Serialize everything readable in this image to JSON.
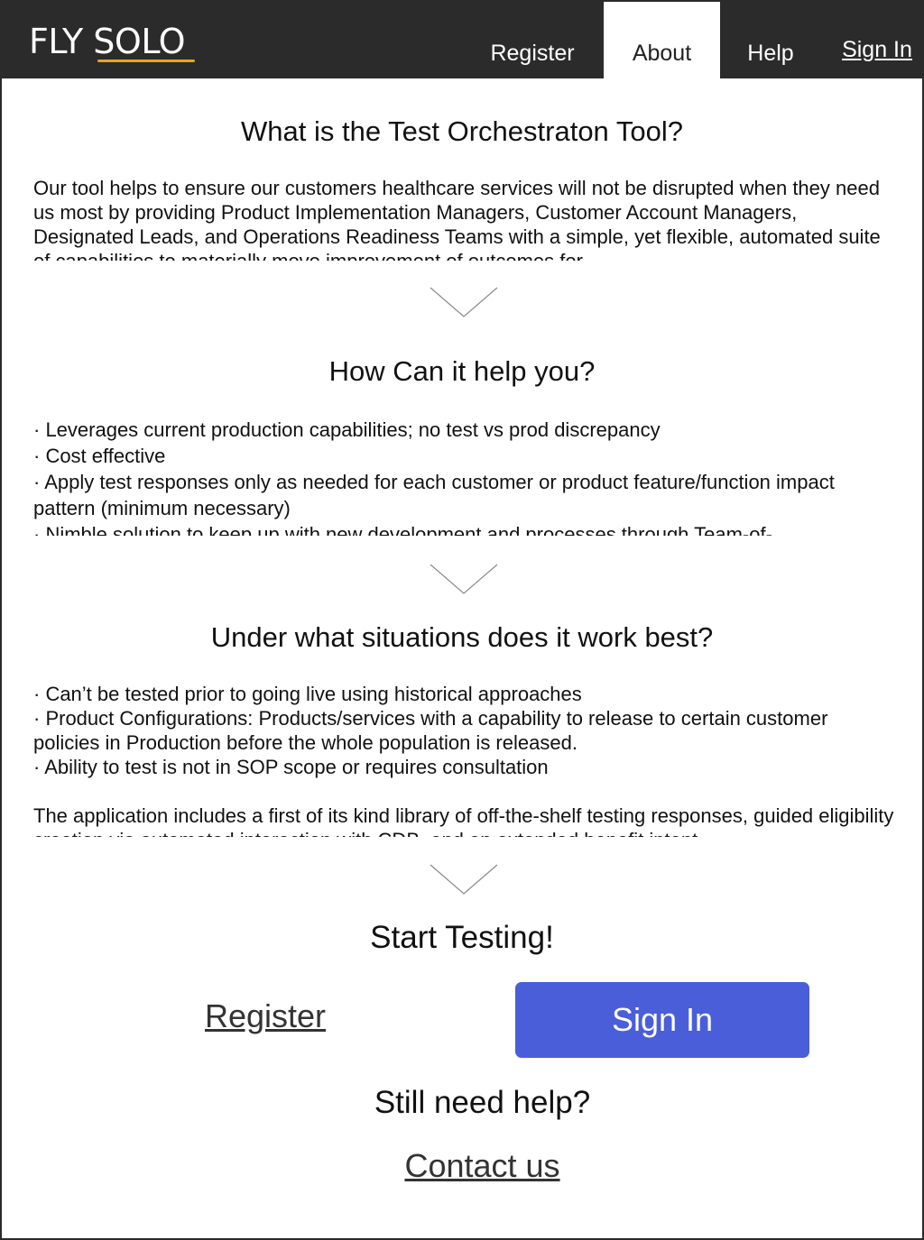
{
  "header": {
    "logo_fly": "FLY",
    "logo_solo": "SOLO",
    "nav": {
      "register": "Register",
      "about": "About",
      "help": "Help",
      "sign_in": "Sign In"
    },
    "active_tab": "About",
    "accent_color": "#e7a51f",
    "bar_color": "#2b2b2b"
  },
  "sections": {
    "what": {
      "title": "What is the Test Orchestraton Tool?",
      "body": "Our tool helps to ensure our customers healthcare services will not be disrupted when they need us most by providing Product Implementation Managers, Customer Account Managers, Designated Leads, and Operations Readiness Teams with a simple, yet flexible, automated suite of capabilities to materially move improvement of outcomes for"
    },
    "how": {
      "title": "How Can it help you?",
      "bullets": [
        "·  Leverages current production capabilities; no test vs prod discrepancy",
        "·  Cost effective",
        "·  Apply test responses only as needed for each customer or product feature/function impact pattern (minimum necessary)",
        "· Nimble solution to keep up with new development and processes through Team-of-"
      ]
    },
    "situations": {
      "title": "Under what situations does it work best?",
      "bullets": [
        "· Can’t be tested prior to going live using historical approaches",
        "· Product Configurations:  Products/services with a  capability to release to certain customer policies in Production before the whole population is released.",
        "· Ability to test is not in SOP scope or requires consultation"
      ],
      "paragraph": "The application includes a first of its kind library of off-the-shelf testing responses, guided eligibility creation via automated interaction with CDB, and an extended benefit intent"
    }
  },
  "cta": {
    "title": "Start Testing!",
    "register_label": "Register",
    "sign_in_label": "Sign In",
    "sign_in_color": "#4a5ed9",
    "help_title": "Still need help?",
    "contact_label": "Contact us"
  }
}
